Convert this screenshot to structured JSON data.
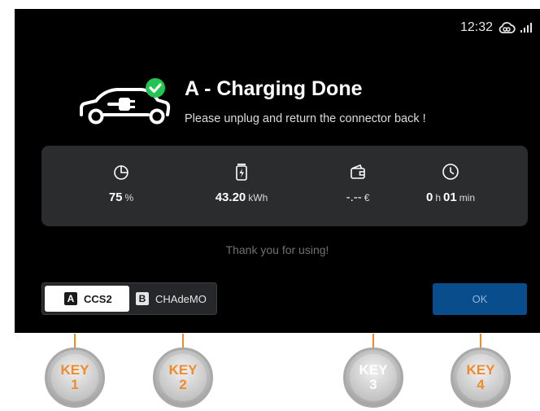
{
  "status": {
    "time": "12:32",
    "icons": [
      "cloud-link-icon",
      "signal-icon"
    ]
  },
  "header": {
    "title": "A - Charging Done",
    "subtitle": "Please unplug and return the connector back !",
    "icon": "car-charging-done-icon"
  },
  "stats": [
    {
      "icon": "pie-chart-icon",
      "value": "75",
      "unit": "%"
    },
    {
      "icon": "battery-icon",
      "value": "43.20",
      "unit": "kWh"
    },
    {
      "icon": "wallet-icon",
      "value": "-.--",
      "unit": "€"
    },
    {
      "icon": "clock-icon",
      "hours": "0",
      "hours_unit": "h",
      "minutes": "01",
      "minutes_unit": "min"
    }
  ],
  "thank_you": "Thank you for using!",
  "connectors": [
    {
      "badge": "A",
      "name": "CCS2",
      "selected": true
    },
    {
      "badge": "B",
      "name": "CHAdeMO",
      "selected": false
    }
  ],
  "ok_label": "OK",
  "keys": [
    {
      "label": "KEY",
      "number": "1",
      "enabled": true
    },
    {
      "label": "KEY",
      "number": "2",
      "enabled": true
    },
    {
      "label": "KEY",
      "number": "3",
      "enabled": false
    },
    {
      "label": "KEY",
      "number": "4",
      "enabled": true
    }
  ],
  "colors": {
    "screen_bg": "#000000",
    "panel_bg": "#2b2c2e",
    "check_green": "#23c552",
    "ok_blue": "#0a4d8c",
    "key_orange": "#f08a2a"
  }
}
